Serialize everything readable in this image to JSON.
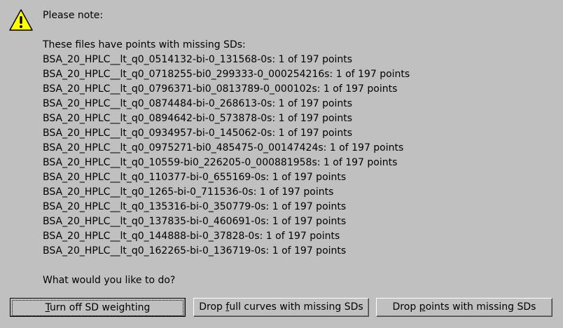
{
  "dialog": {
    "heading": "Please note:",
    "intro": "These files have points with missing SDs:",
    "files": [
      "BSA_20_HPLC__lt_q0_0514132-bi-0_131568-0s: 1 of 197 points",
      "BSA_20_HPLC__lt_q0_0718255-bi0_299333-0_000254216s: 1 of 197 points",
      "BSA_20_HPLC__lt_q0_0796371-bi0_0813789-0_000102s: 1 of 197 points",
      "BSA_20_HPLC__lt_q0_0874484-bi-0_268613-0s: 1 of 197 points",
      "BSA_20_HPLC__lt_q0_0894642-bi-0_573878-0s: 1 of 197 points",
      "BSA_20_HPLC__lt_q0_0934957-bi-0_145062-0s: 1 of 197 points",
      "BSA_20_HPLC__lt_q0_0975271-bi0_485475-0_00147424s: 1 of 197 points",
      "BSA_20_HPLC__lt_q0_10559-bi0_226205-0_000881958s: 1 of 197 points",
      "BSA_20_HPLC__lt_q0_110377-bi-0_655169-0s: 1 of 197 points",
      "BSA_20_HPLC__lt_q0_1265-bi-0_711536-0s: 1 of 197 points",
      "BSA_20_HPLC__lt_q0_135316-bi-0_350779-0s: 1 of 197 points",
      "BSA_20_HPLC__lt_q0_137835-bi-0_460691-0s: 1 of 197 points",
      "BSA_20_HPLC__lt_q0_144888-bi-0_37828-0s: 1 of 197 points",
      "BSA_20_HPLC__lt_q0_162265-bi-0_136719-0s: 1 of 197 points"
    ],
    "question": "What would you like to do?",
    "icon": "warning-icon",
    "icon_color": "#ffff00"
  },
  "buttons": {
    "turn_off": {
      "mnemonic": "T",
      "rest": "urn off SD weighting"
    },
    "drop_curves": {
      "before": "Drop ",
      "mnemonic": "f",
      "rest": "ull curves with missing SDs"
    },
    "drop_points": {
      "before": "Drop ",
      "mnemonic": "p",
      "rest": "oints with missing SDs"
    }
  }
}
